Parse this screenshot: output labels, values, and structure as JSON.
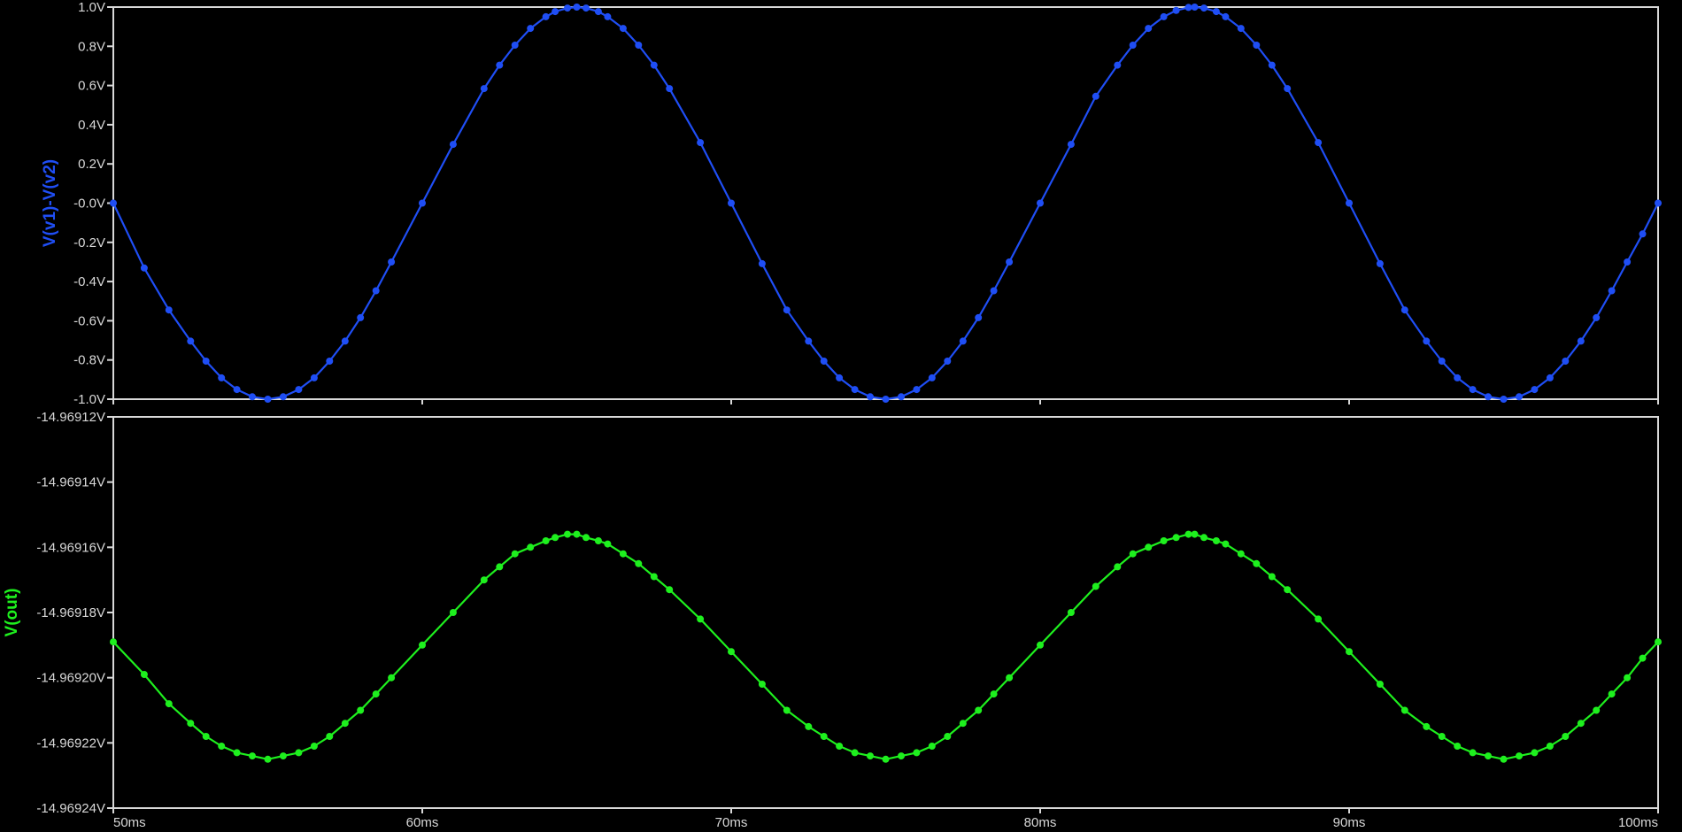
{
  "colors": {
    "background": "#000000",
    "frame": "#d8d8d8",
    "tick_text": "#d8d8d8",
    "trace_top": "#1f4ef5",
    "trace_bottom": "#1ef01e"
  },
  "chart_data": [
    {
      "type": "line",
      "title": "",
      "xlabel": "",
      "ylabel": "V(v1)-V(v2)",
      "xlim": [
        50,
        100
      ],
      "ylim": [
        -1.0,
        1.0
      ],
      "x_tick_labels": [
        "50ms",
        "60ms",
        "70ms",
        "80ms",
        "90ms",
        "100ms"
      ],
      "y_tick_labels": [
        "1.0V",
        "0.8V",
        "0.6V",
        "0.4V",
        "0.2V",
        "-0.0V",
        "-0.2V",
        "-0.4V",
        "-0.6V",
        "-0.8V",
        "-1.0V"
      ],
      "grid": false,
      "markers": true,
      "series": [
        {
          "name": "V(v1)-V(v2)",
          "color": "#1f4ef5",
          "x": [
            50.0,
            51.0,
            51.8,
            52.5,
            53.0,
            53.5,
            54.0,
            54.5,
            55.0,
            55.5,
            56.0,
            56.5,
            57.0,
            57.5,
            58.0,
            58.5,
            59.0,
            60.0,
            61.0,
            62.0,
            62.5,
            63.0,
            63.5,
            64.0,
            64.3,
            64.7,
            65.0,
            65.3,
            65.7,
            66.0,
            66.5,
            67.0,
            67.5,
            68.0,
            69.0,
            70.0,
            71.0,
            71.8,
            72.5,
            73.0,
            73.5,
            74.0,
            74.5,
            75.0,
            75.5,
            76.0,
            76.5,
            77.0,
            77.5,
            78.0,
            78.5,
            79.0,
            80.0,
            81.0,
            81.8,
            82.5,
            83.0,
            83.5,
            84.0,
            84.4,
            84.8,
            85.0,
            85.3,
            85.7,
            86.0,
            86.5,
            87.0,
            87.5,
            88.0,
            89.0,
            90.0,
            91.0,
            91.8,
            92.5,
            93.0,
            93.5,
            94.0,
            94.5,
            95.0,
            95.5,
            96.0,
            96.5,
            97.0,
            97.5,
            98.0,
            98.5,
            99.0,
            99.5,
            100.0
          ],
          "y": [
            0.0,
            -0.331,
            -0.545,
            -0.704,
            -0.806,
            -0.891,
            -0.951,
            -0.988,
            -1.0,
            -0.988,
            -0.951,
            -0.891,
            -0.806,
            -0.704,
            -0.584,
            -0.447,
            -0.3,
            0.0,
            0.3,
            0.584,
            0.704,
            0.806,
            0.891,
            0.951,
            0.977,
            0.995,
            1.0,
            0.995,
            0.977,
            0.951,
            0.891,
            0.806,
            0.704,
            0.584,
            0.309,
            0.0,
            -0.309,
            -0.545,
            -0.704,
            -0.806,
            -0.891,
            -0.951,
            -0.988,
            -1.0,
            -0.988,
            -0.951,
            -0.891,
            -0.806,
            -0.704,
            -0.584,
            -0.447,
            -0.3,
            0.0,
            0.3,
            0.545,
            0.704,
            0.806,
            0.891,
            0.951,
            0.983,
            0.998,
            1.0,
            0.995,
            0.977,
            0.951,
            0.891,
            0.806,
            0.704,
            0.584,
            0.309,
            0.0,
            -0.309,
            -0.545,
            -0.704,
            -0.806,
            -0.891,
            -0.951,
            -0.988,
            -1.0,
            -0.988,
            -0.951,
            -0.891,
            -0.806,
            -0.704,
            -0.584,
            -0.447,
            -0.3,
            -0.157,
            0.0
          ]
        }
      ]
    },
    {
      "type": "line",
      "title": "",
      "xlabel": "",
      "ylabel": "V(out)",
      "xlim": [
        50,
        100
      ],
      "ylim": [
        -14.96924,
        -14.96912
      ],
      "x_tick_labels": [
        "50ms",
        "60ms",
        "70ms",
        "80ms",
        "90ms",
        "100ms"
      ],
      "y_tick_labels": [
        "-14.96912V",
        "-14.96914V",
        "-14.96916V",
        "-14.96918V",
        "-14.96920V",
        "-14.96922V",
        "-14.96924V"
      ],
      "grid": false,
      "markers": true,
      "series": [
        {
          "name": "V(out)",
          "color": "#1ef01e",
          "x": [
            50.0,
            51.0,
            51.8,
            52.5,
            53.0,
            53.5,
            54.0,
            54.5,
            55.0,
            55.5,
            56.0,
            56.5,
            57.0,
            57.5,
            58.0,
            58.5,
            59.0,
            60.0,
            61.0,
            62.0,
            62.5,
            63.0,
            63.5,
            64.0,
            64.3,
            64.7,
            65.0,
            65.3,
            65.7,
            66.0,
            66.5,
            67.0,
            67.5,
            68.0,
            69.0,
            70.0,
            71.0,
            71.8,
            72.5,
            73.0,
            73.5,
            74.0,
            74.5,
            75.0,
            75.5,
            76.0,
            76.5,
            77.0,
            77.5,
            78.0,
            78.5,
            79.0,
            80.0,
            81.0,
            81.8,
            82.5,
            83.0,
            83.5,
            84.0,
            84.4,
            84.8,
            85.0,
            85.3,
            85.7,
            86.0,
            86.5,
            87.0,
            87.5,
            88.0,
            89.0,
            90.0,
            91.0,
            91.8,
            92.5,
            93.0,
            93.5,
            94.0,
            94.5,
            95.0,
            95.5,
            96.0,
            96.5,
            97.0,
            97.5,
            98.0,
            98.5,
            99.0,
            99.5,
            100.0
          ],
          "y": [
            -14.969189,
            -14.969199,
            -14.969208,
            -14.969214,
            -14.969218,
            -14.969221,
            -14.969223,
            -14.969224,
            -14.969225,
            -14.969224,
            -14.969223,
            -14.969221,
            -14.969218,
            -14.969214,
            -14.96921,
            -14.969205,
            -14.9692,
            -14.96919,
            -14.96918,
            -14.96917,
            -14.969166,
            -14.969162,
            -14.96916,
            -14.969158,
            -14.969157,
            -14.969156,
            -14.969156,
            -14.969157,
            -14.969158,
            -14.969159,
            -14.969162,
            -14.969165,
            -14.969169,
            -14.969173,
            -14.969182,
            -14.969192,
            -14.969202,
            -14.96921,
            -14.969215,
            -14.969218,
            -14.969221,
            -14.969223,
            -14.969224,
            -14.969225,
            -14.969224,
            -14.969223,
            -14.969221,
            -14.969218,
            -14.969214,
            -14.96921,
            -14.969205,
            -14.9692,
            -14.96919,
            -14.96918,
            -14.969172,
            -14.969166,
            -14.969162,
            -14.96916,
            -14.969158,
            -14.969157,
            -14.969156,
            -14.969156,
            -14.969157,
            -14.969158,
            -14.969159,
            -14.969162,
            -14.969165,
            -14.969169,
            -14.969173,
            -14.969182,
            -14.969192,
            -14.969202,
            -14.96921,
            -14.969215,
            -14.969218,
            -14.969221,
            -14.969223,
            -14.969224,
            -14.969225,
            -14.969224,
            -14.969223,
            -14.969221,
            -14.969218,
            -14.969214,
            -14.96921,
            -14.969205,
            -14.9692,
            -14.969194,
            -14.969189
          ]
        }
      ]
    }
  ]
}
